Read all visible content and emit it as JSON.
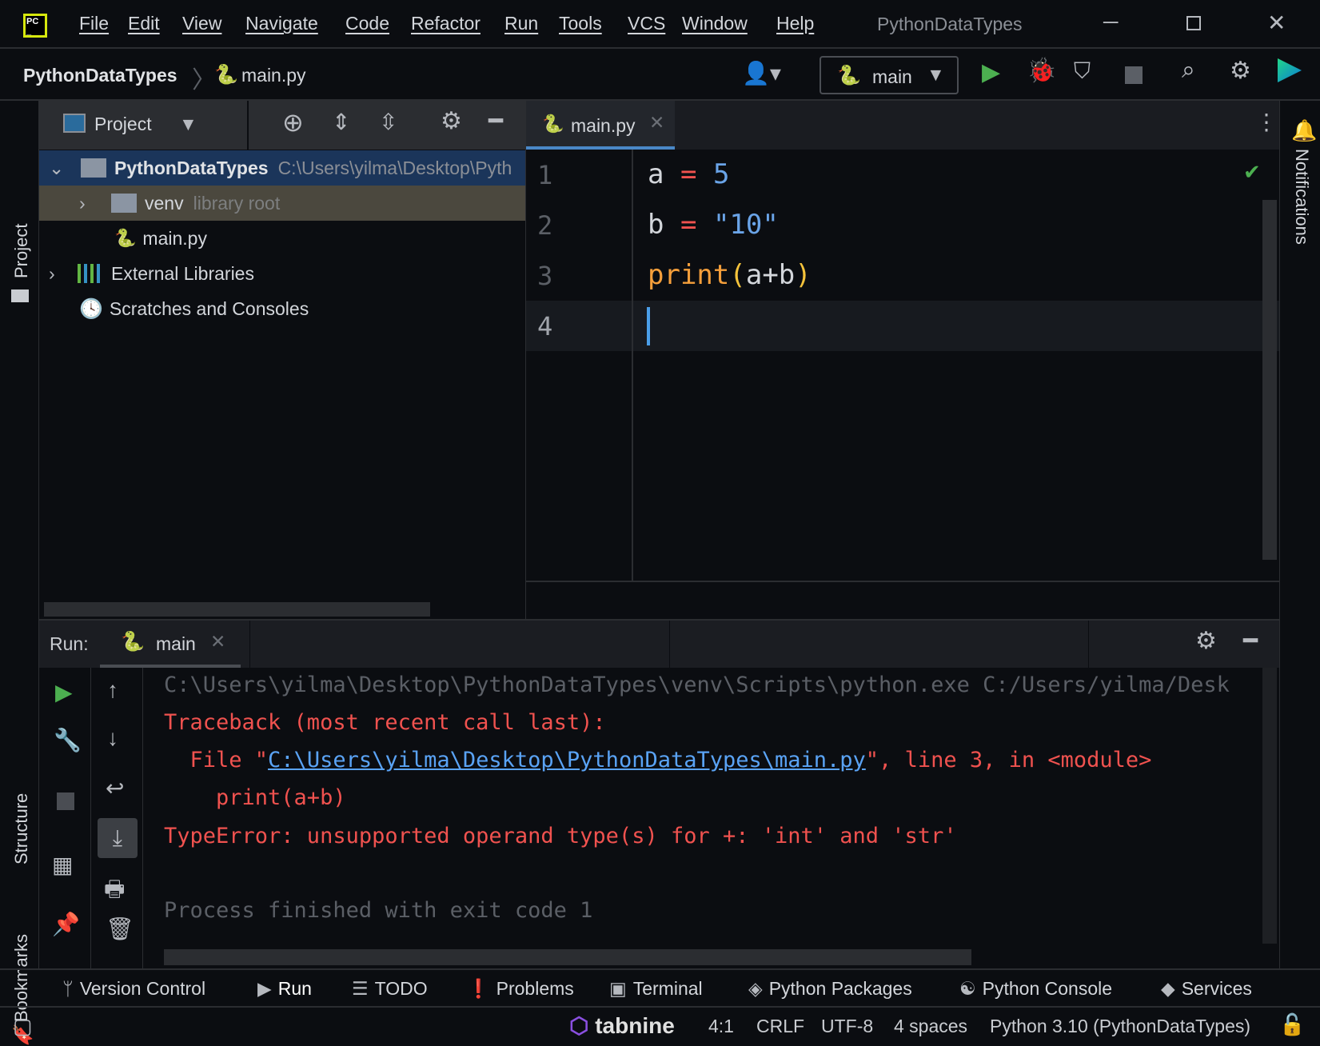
{
  "menubar": {
    "items": [
      "File",
      "Edit",
      "View",
      "Navigate",
      "Code",
      "Refactor",
      "Run",
      "Tools",
      "VCS",
      "Window",
      "Help"
    ],
    "title": "PythonDataTypes"
  },
  "navbar": {
    "project": "PythonDataTypes",
    "file": "main.py",
    "run_config": "main"
  },
  "left_strip": {
    "project": "Project",
    "structure": "Structure",
    "bookmarks": "Bookmarks"
  },
  "right_strip": {
    "notifications": "Notifications"
  },
  "project_panel": {
    "title": "Project",
    "tree": [
      {
        "name": "PythonDataTypes",
        "hint": "C:\\Users\\yilma\\Desktop\\Pyth"
      },
      {
        "name": "venv",
        "hint": "library root"
      },
      {
        "name": "main.py",
        "hint": ""
      },
      {
        "name": "External Libraries",
        "hint": ""
      },
      {
        "name": "Scratches and Consoles",
        "hint": ""
      }
    ]
  },
  "editor": {
    "tab": "main.py",
    "line_numbers": [
      "1",
      "2",
      "3",
      "4"
    ],
    "lines": [
      {
        "var": "a",
        "op": "=",
        "val": "5"
      },
      {
        "var": "b",
        "op": "=",
        "val": "\"10\""
      },
      {
        "fn": "print",
        "open": "(",
        "args": "a+b",
        "close": ")"
      }
    ]
  },
  "run_panel": {
    "label": "Run:",
    "tab": "main",
    "console": {
      "cmd": "C:\\Users\\yilma\\Desktop\\PythonDataTypes\\venv\\Scripts\\python.exe C:/Users/yilma/Desk",
      "traceback": "Traceback (most recent call last):",
      "file_prefix": "  File \"",
      "file_link": "C:\\Users\\yilma\\Desktop\\PythonDataTypes\\main.py",
      "file_suffix": "\", line 3, in <module>",
      "code_line": "    print(a+b)",
      "error": "TypeError: unsupported operand type(s) for +: 'int' and 'str'",
      "exit": "Process finished with exit code 1"
    }
  },
  "bottom_toolbar": [
    "Version Control",
    "Run",
    "TODO",
    "Problems",
    "Terminal",
    "Python Packages",
    "Python Console",
    "Services"
  ],
  "status": {
    "plugin": "tabnine",
    "position": "4:1",
    "line_sep": "CRLF",
    "encoding": "UTF-8",
    "indent": "4 spaces",
    "interpreter": "Python 3.10 (PythonDataTypes)"
  },
  "colors": {
    "accent": "#4a88c7",
    "error": "#f0524f",
    "keyword_op": "#f0524f",
    "number": "#6aa4e8",
    "function": "#f59f3b",
    "run_green": "#4caf50"
  }
}
